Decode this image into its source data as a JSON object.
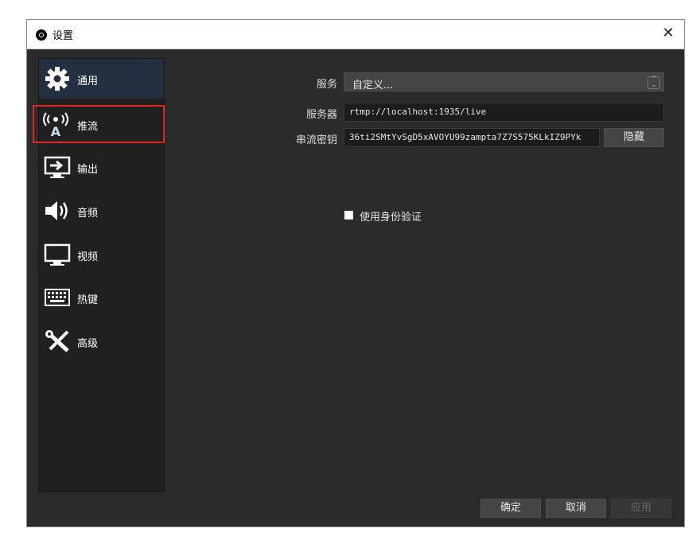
{
  "window": {
    "title": "设置",
    "close_glyph": "✕"
  },
  "sidebar": {
    "items": [
      {
        "label": "通用",
        "icon": "gear-icon"
      },
      {
        "label": "推流",
        "icon": "antenna-icon"
      },
      {
        "label": "输出",
        "icon": "output-icon"
      },
      {
        "label": "音频",
        "icon": "speaker-icon"
      },
      {
        "label": "视频",
        "icon": "monitor-icon"
      },
      {
        "label": "热键",
        "icon": "keyboard-icon"
      },
      {
        "label": "高级",
        "icon": "tools-icon"
      }
    ]
  },
  "stream": {
    "service_label": "服务",
    "service_value": "自定义...",
    "server_label": "服务器",
    "server_value": "rtmp://localhost:1935/live",
    "key_label": "串流密钥",
    "key_value": "36ti2SMtYvSgD5xAVOYU99zampta7Z7S575KLkIZ9PYk",
    "hide_button": "隐藏",
    "auth_label": "使用身份验证"
  },
  "footer": {
    "ok": "确定",
    "cancel": "取消",
    "apply": "应用"
  },
  "colors": {
    "highlight_border": "#e02424",
    "active_item": "#243040"
  }
}
